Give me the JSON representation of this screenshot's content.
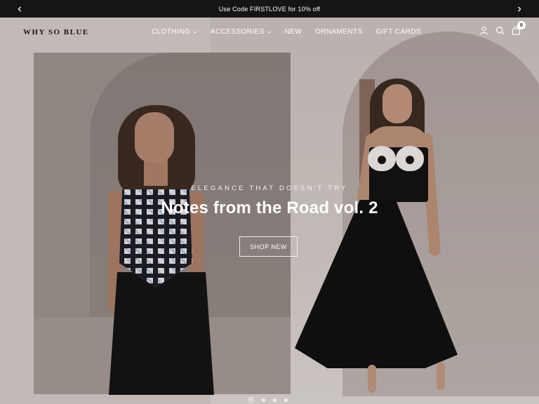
{
  "announcement": {
    "text": "Use Code FIRSTLOVE for 10% off",
    "prev_icon": "chevron-left-icon",
    "next_icon": "chevron-right-icon"
  },
  "header": {
    "logo": "WHY SO BLUE",
    "nav": [
      {
        "label": "CLOTHING",
        "has_dropdown": true
      },
      {
        "label": "ACCESSORIES",
        "has_dropdown": true
      },
      {
        "label": "NEW",
        "has_dropdown": false
      },
      {
        "label": "ORNAMENTS",
        "has_dropdown": false
      },
      {
        "label": "GIFT CARDS",
        "has_dropdown": false
      }
    ],
    "icons": [
      "account-icon",
      "search-icon",
      "cart-icon"
    ],
    "cart_count": "0"
  },
  "hero": {
    "eyebrow": "ELEGANCE THAT DOESN'T TRY",
    "title": "Notes from the Road vol. 2",
    "cta": "SHOP NEW",
    "slides_total": 4,
    "active_slide": 1
  },
  "colors": {
    "announcement_bg": "#151515",
    "text_light": "#ffffff"
  }
}
